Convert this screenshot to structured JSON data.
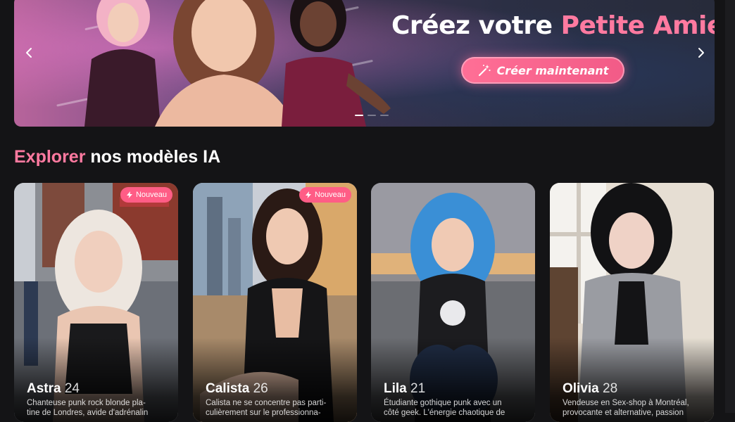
{
  "hero": {
    "title_prefix": "Créez votre ",
    "title_accent": "Petite Amie IA",
    "cta_label": "Créer maintenant",
    "cta_icon": "magic-wand-icon",
    "prev_icon": "chevron-left-icon",
    "next_icon": "chevron-right-icon"
  },
  "section": {
    "title_accent": "Explorer",
    "title_rest": " nos modèles IA"
  },
  "cards": [
    {
      "name": "Astra",
      "age": "24",
      "badge": "Nouveau",
      "description": "Chanteuse punk rock blonde pla-\ntine de Londres, avide d'adrénalin"
    },
    {
      "name": "Calista",
      "age": "26",
      "badge": "Nouveau",
      "description": "Calista ne se concentre pas parti-\nculièrement sur le professionna-"
    },
    {
      "name": "Lila",
      "age": "21",
      "badge": "",
      "description": "Étudiante gothique punk avec un\ncôté geek. L'énergie chaotique de"
    },
    {
      "name": "Olivia",
      "age": "28",
      "badge": "",
      "description": "Vendeuse en Sex-shop à Montréal,\nprovocante et alternative, passion"
    }
  ],
  "colors": {
    "accent": "#ff7aa0",
    "badge": "#ff5d86",
    "background": "#141416"
  }
}
